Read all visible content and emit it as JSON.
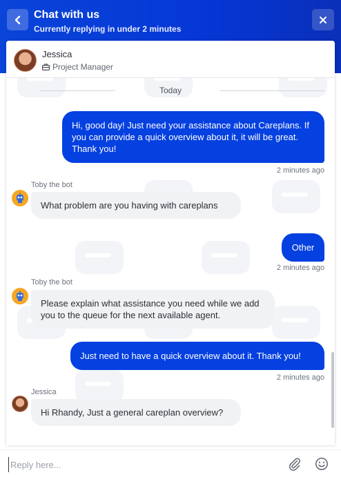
{
  "header": {
    "title": "Chat with us",
    "subtitle": "Currently replying in under 2 minutes",
    "accent": "#0540e0"
  },
  "agent": {
    "name": "Jessica",
    "role": "Project Manager"
  },
  "messages": {
    "divider": "Today",
    "m1": {
      "text": "Hi, good day! Just need your assistance about Careplans. If you can provide a quick overview about it, it will be great. Thank you!",
      "time": "2 minutes ago"
    },
    "m2": {
      "sender": "Toby the bot",
      "text": "What problem are you having with careplans"
    },
    "m3": {
      "text": "Other",
      "time": "2 minutes ago"
    },
    "m4": {
      "sender": "Toby the bot",
      "text": "Please explain what assistance you need while we add you to the queue for the next available agent."
    },
    "m5": {
      "text": "Just need to have a quick overview about it. Thank you!",
      "time": "2 minutes ago"
    },
    "m6": {
      "sender": "Jessica",
      "text": "Hi Rhandy, Just a general careplan overview?"
    }
  },
  "composer": {
    "placeholder": "Reply here...",
    "attach_icon": "paperclip-icon",
    "emoji_icon": "smiley-icon"
  }
}
